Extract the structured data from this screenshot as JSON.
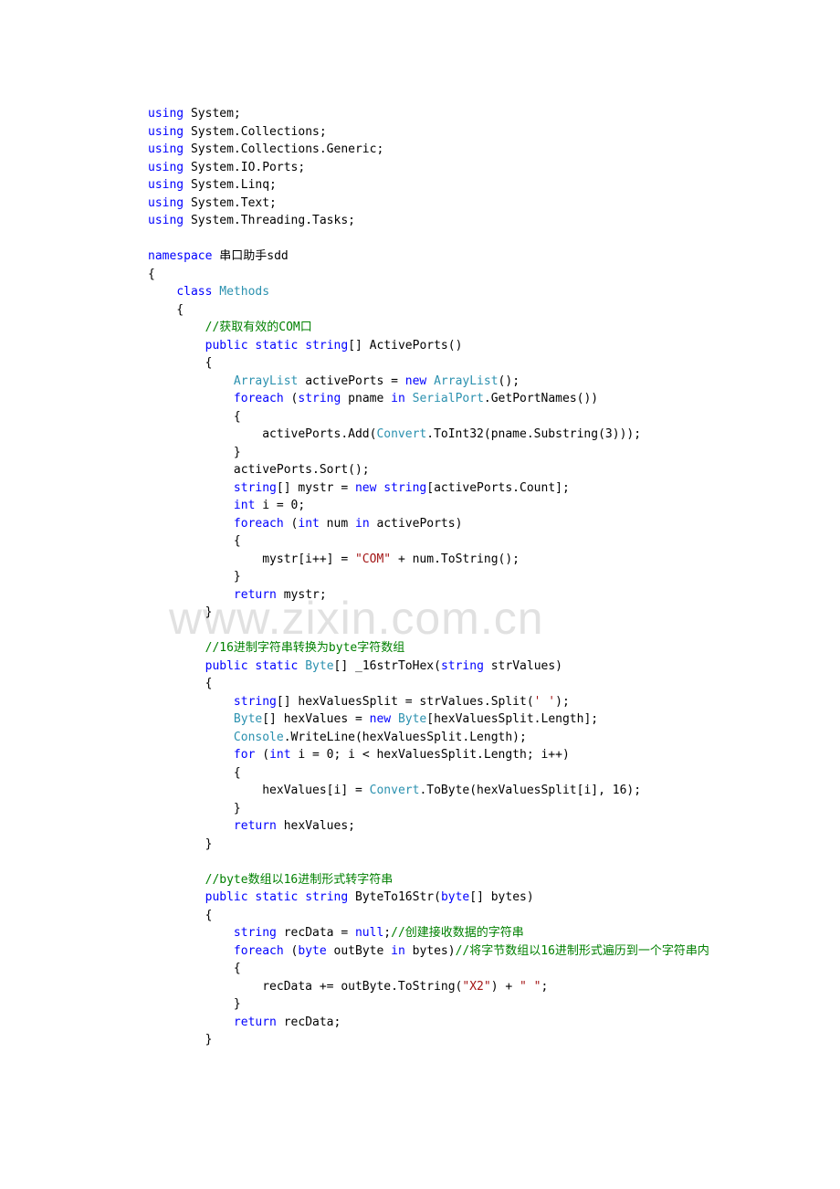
{
  "watermark": "www.zixin.com.cn",
  "code": {
    "l01a": "using",
    "l01b": " System;",
    "l02a": "using",
    "l02b": " System.Collections;",
    "l03a": "using",
    "l03b": " System.Collections.Generic;",
    "l04a": "using",
    "l04b": " System.IO.Ports;",
    "l05a": "using",
    "l05b": " System.Linq;",
    "l06a": "using",
    "l06b": " System.Text;",
    "l07a": "using",
    "l07b": " System.Threading.Tasks;",
    "blank1": "",
    "l08a": "namespace",
    "l08b": " 串口助手sdd",
    "l09": "{",
    "l10a": "    ",
    "l10b": "class",
    "l10c": " ",
    "l10d": "Methods",
    "l11": "    {",
    "l12a": "        ",
    "l12b": "//获取有效的COM口",
    "l13a": "        ",
    "l13b": "public",
    "l13c": " ",
    "l13d": "static",
    "l13e": " ",
    "l13f": "string",
    "l13g": "[] ActivePorts()",
    "l14": "        {",
    "l15a": "            ",
    "l15b": "ArrayList",
    "l15c": " activePorts = ",
    "l15d": "new",
    "l15e": " ",
    "l15f": "ArrayList",
    "l15g": "();",
    "l16a": "            ",
    "l16b": "foreach",
    "l16c": " (",
    "l16d": "string",
    "l16e": " pname ",
    "l16f": "in",
    "l16g": " ",
    "l16h": "SerialPort",
    "l16i": ".GetPortNames())",
    "l17": "            {",
    "l18a": "                activePorts.Add(",
    "l18b": "Convert",
    "l18c": ".ToInt32(pname.Substring(3)));",
    "l19": "            }",
    "l20": "            activePorts.Sort();",
    "l21a": "            ",
    "l21b": "string",
    "l21c": "[] mystr = ",
    "l21d": "new",
    "l21e": " ",
    "l21f": "string",
    "l21g": "[activePorts.Count];",
    "l22a": "            ",
    "l22b": "int",
    "l22c": " i = 0;",
    "l23a": "            ",
    "l23b": "foreach",
    "l23c": " (",
    "l23d": "int",
    "l23e": " num ",
    "l23f": "in",
    "l23g": " activePorts)",
    "l24": "            {",
    "l25a": "                mystr[i++] = ",
    "l25b": "\"COM\"",
    "l25c": " + num.ToString();",
    "l26": "            }",
    "l27a": "            ",
    "l27b": "return",
    "l27c": " mystr;",
    "l28": "        }",
    "blank2": "",
    "l29a": "        ",
    "l29b": "//16进制字符串转换为byte字符数组",
    "l30a": "        ",
    "l30b": "public",
    "l30c": " ",
    "l30d": "static",
    "l30e": " ",
    "l30f": "Byte",
    "l30g": "[] _16strToHex(",
    "l30h": "string",
    "l30i": " strValues)",
    "l31": "        {",
    "l32a": "            ",
    "l32b": "string",
    "l32c": "[] hexValuesSplit = strValues.Split(",
    "l32d": "' '",
    "l32e": ");",
    "l33a": "            ",
    "l33b": "Byte",
    "l33c": "[] hexValues = ",
    "l33d": "new",
    "l33e": " ",
    "l33f": "Byte",
    "l33g": "[hexValuesSplit.Length];",
    "l34a": "            ",
    "l34b": "Console",
    "l34c": ".WriteLine(hexValuesSplit.Length);",
    "l35a": "            ",
    "l35b": "for",
    "l35c": " (",
    "l35d": "int",
    "l35e": " i = 0; i < hexValuesSplit.Length; i++)",
    "l36": "            {",
    "l37a": "                hexValues[i] = ",
    "l37b": "Convert",
    "l37c": ".ToByte(hexValuesSplit[i], 16);",
    "l38": "            }",
    "l39a": "            ",
    "l39b": "return",
    "l39c": " hexValues;",
    "l40": "        }",
    "blank3": "",
    "l41a": "        ",
    "l41b": "//byte数组以16进制形式转字符串",
    "l42a": "        ",
    "l42b": "public",
    "l42c": " ",
    "l42d": "static",
    "l42e": " ",
    "l42f": "string",
    "l42g": " ByteTo16Str(",
    "l42h": "byte",
    "l42i": "[] bytes)",
    "l43": "        {",
    "l44a": "            ",
    "l44b": "string",
    "l44c": " recData = ",
    "l44d": "null",
    "l44e": ";",
    "l44f": "//创建接收数据的字符串",
    "l45a": "            ",
    "l45b": "foreach",
    "l45c": " (",
    "l45d": "byte",
    "l45e": " outByte ",
    "l45f": "in",
    "l45g": " bytes)",
    "l45h": "//将字节数组以16进制形式遍历到一个字符串内",
    "l46": "            {",
    "l47a": "                recData += outByte.ToString(",
    "l47b": "\"X2\"",
    "l47c": ") + ",
    "l47d": "\" \"",
    "l47e": ";",
    "l48": "            }",
    "l49a": "            ",
    "l49b": "return",
    "l49c": " recData;",
    "l50": "        }"
  }
}
